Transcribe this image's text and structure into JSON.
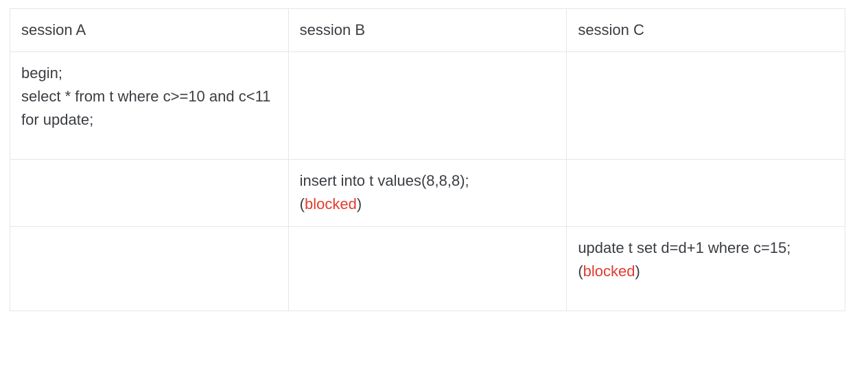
{
  "table": {
    "headers": [
      "session A",
      "session B",
      "session C"
    ],
    "rows": [
      {
        "a": "begin;\nselect * from t where c>=10 and c<11 for update;",
        "b": "",
        "c": ""
      },
      {
        "a": "",
        "b": {
          "sql": "insert into t values(8,8,8);",
          "status": "blocked"
        },
        "c": ""
      },
      {
        "a": "",
        "b": "",
        "c": {
          "sql": "update t set d=d+1 where c=15;",
          "status": "blocked"
        }
      }
    ]
  }
}
